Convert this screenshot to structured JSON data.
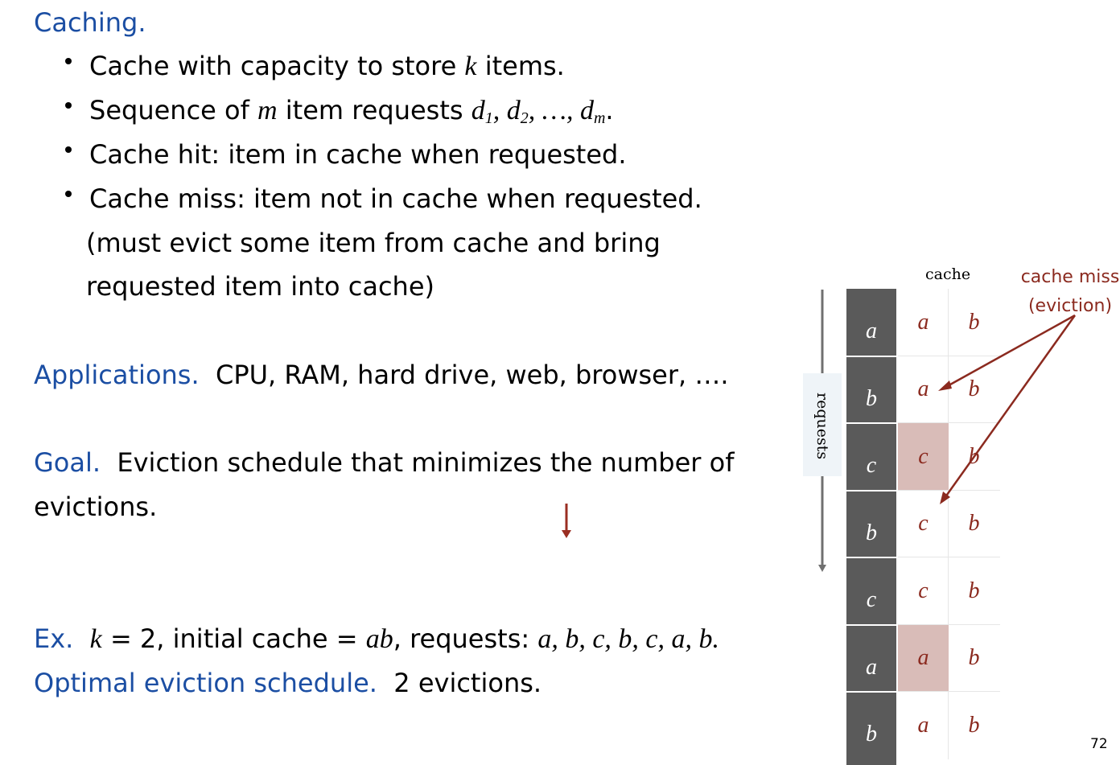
{
  "slide": {
    "heading": "Caching.",
    "bullets": [
      {
        "pre": "Cache with capacity to store ",
        "var": "k",
        "post": " items."
      },
      {
        "pre": "Sequence of ",
        "var": "m",
        "mid": " item requests ",
        "seq": [
          "d",
          "1",
          "d",
          "2",
          "d",
          "m"
        ],
        "post": "."
      },
      {
        "text": "Cache hit:  item in cache when requested."
      },
      {
        "text": "Cache miss:  item not in cache when requested."
      }
    ],
    "miss_note_line1": "(must evict some item from cache and bring",
    "miss_note_line2": "requested item into cache)",
    "applications_label": "Applications.",
    "applications_text": "CPU, RAM, hard drive, web, browser, ….",
    "goal_label": "Goal.",
    "goal_text_line1": "Eviction schedule that minimizes the number of",
    "goal_text_line2": "evictions.",
    "example_label": "Ex.",
    "example_k_var": "k",
    "example_k_text": " = 2, initial cache = ",
    "example_cache": "ab",
    "example_requests_label": ", requests:  ",
    "example_requests": "a, b, c, b, c, a, b.",
    "optimal_label": "Optimal eviction schedule.",
    "optimal_text": "2 evictions.",
    "page_number": "72"
  },
  "diagram": {
    "cache_title": "cache",
    "requests_label": "requests",
    "miss_label_line1": "cache miss",
    "miss_label_line2": "(eviction)",
    "rows": [
      {
        "request": "a",
        "cache": [
          "a",
          "b"
        ],
        "evicted_slot": null
      },
      {
        "request": "b",
        "cache": [
          "a",
          "b"
        ],
        "evicted_slot": null
      },
      {
        "request": "c",
        "cache": [
          "c",
          "b"
        ],
        "evicted_slot": 0
      },
      {
        "request": "b",
        "cache": [
          "c",
          "b"
        ],
        "evicted_slot": null
      },
      {
        "request": "c",
        "cache": [
          "c",
          "b"
        ],
        "evicted_slot": null
      },
      {
        "request": "a",
        "cache": [
          "a",
          "b"
        ],
        "evicted_slot": 0
      },
      {
        "request": "b",
        "cache": [
          "a",
          "b"
        ],
        "evicted_slot": null
      }
    ],
    "colors": {
      "accent": "#8b2a1f",
      "evict_fill": "#d9bcb8",
      "request_fill": "#5a5a5a",
      "heading_blue": "#1b4ea3"
    }
  }
}
